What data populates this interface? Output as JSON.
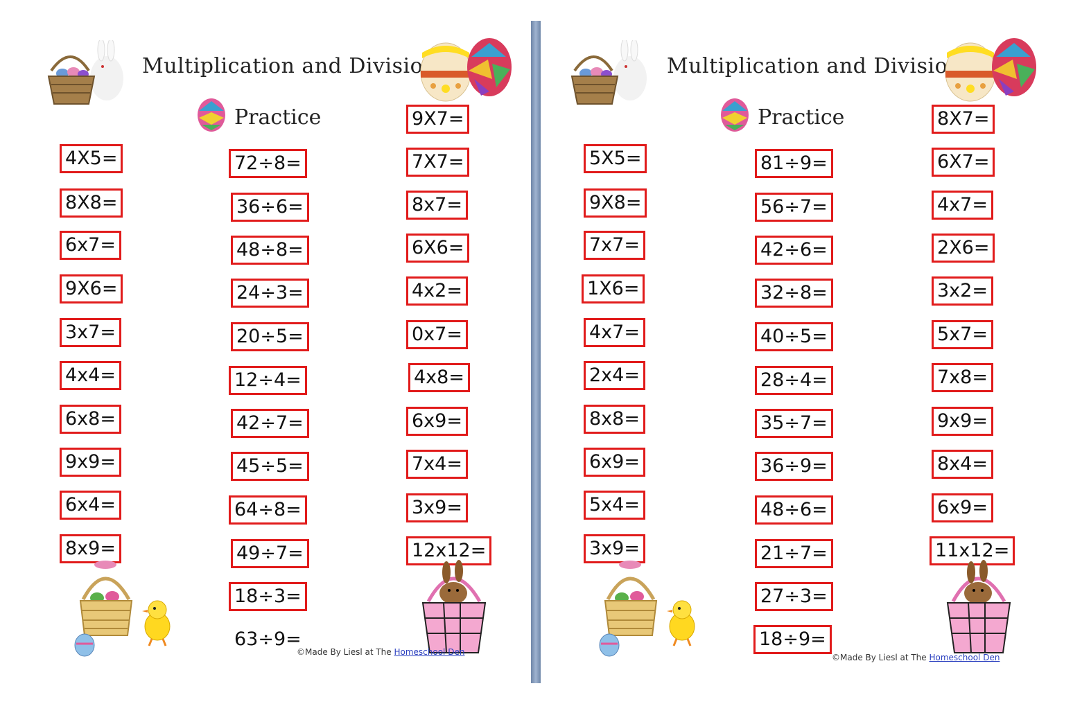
{
  "pages": [
    {
      "title": "Multiplication and Division",
      "subtitle": "Practice",
      "col1": [
        "4X5=",
        "8X8=",
        "6x7=",
        "9X6=",
        "3x7=",
        "4x4=",
        "6x8=",
        "9x9=",
        "6x4=",
        "8x9="
      ],
      "col2": [
        "72÷8=",
        "36÷6=",
        "48÷8=",
        "24÷3=",
        "20÷5=",
        "12÷4=",
        "42÷7=",
        "45÷5=",
        "64÷8=",
        "49÷7=",
        "18÷3=",
        "63÷9="
      ],
      "col3": [
        "9X7=",
        "7X7=",
        "8x7=",
        "6X6=",
        "4x2=",
        "0x7=",
        "4x8=",
        "6x9=",
        "7x4=",
        "3x9=",
        "12x12="
      ],
      "credit_prefix": "©Made By Liesl at The ",
      "credit_link": "Homeschool Den"
    },
    {
      "title": "Multiplication and Division",
      "subtitle": "Practice",
      "col1": [
        "5X5=",
        "9X8=",
        "7x7=",
        "1X6=",
        "4x7=",
        "2x4=",
        "8x8=",
        "6x9=",
        "5x4=",
        "3x9="
      ],
      "col2": [
        "81÷9=",
        "56÷7=",
        "42÷6=",
        "32÷8=",
        "40÷5=",
        "28÷4=",
        "35÷7=",
        "36÷9=",
        "48÷6=",
        "21÷7=",
        "27÷3=",
        "18÷9="
      ],
      "col3": [
        "8X7=",
        "6X7=",
        "4x7=",
        "2X6=",
        "3x2=",
        "5x7=",
        "7x8=",
        "9x9=",
        "8x4=",
        "6x9=",
        "11x12="
      ],
      "credit_prefix": "©Made By Liesl at The ",
      "credit_link": "Homeschool Den"
    }
  ],
  "colors": {
    "box": "#e11b1b",
    "link": "#2a3fbf",
    "divider": "#7f96b8"
  },
  "icons": [
    "easter-basket-bunny-icon",
    "easter-egg-icon",
    "patchwork-egg-icon",
    "egg-basket-icon",
    "chick-icon",
    "bunny-basket-icon"
  ]
}
